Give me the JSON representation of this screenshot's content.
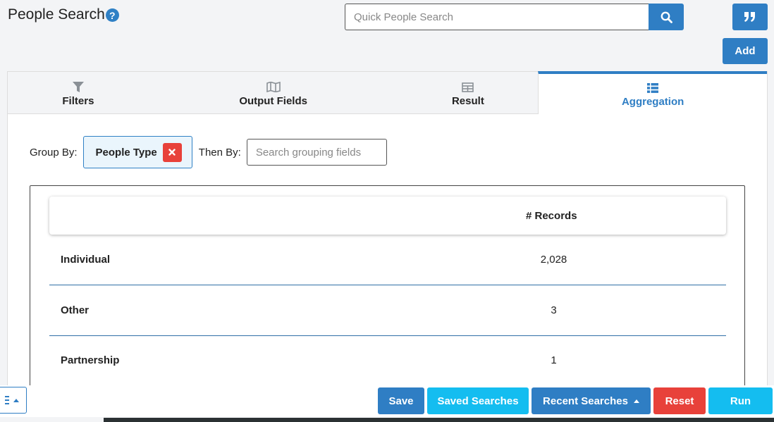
{
  "header": {
    "title": "People Search",
    "help_glyph": "?",
    "quick_search_placeholder": "Quick People Search",
    "add_label": "Add"
  },
  "tabs": [
    {
      "label": "Filters",
      "icon": "filter-icon"
    },
    {
      "label": "Output Fields",
      "icon": "map-icon"
    },
    {
      "label": "Result",
      "icon": "table-icon"
    },
    {
      "label": "Aggregation",
      "icon": "list-icon",
      "active": true
    }
  ],
  "grouping": {
    "group_by_label": "Group By:",
    "group_chip": "People Type",
    "then_by_label": "Then By:",
    "then_by_placeholder": "Search grouping fields"
  },
  "results": {
    "column_header": "# Records",
    "rows": [
      {
        "name": "Individual",
        "count": "2,028"
      },
      {
        "name": "Other",
        "count": "3"
      },
      {
        "name": "Partnership",
        "count": "1"
      }
    ]
  },
  "footer": {
    "save": "Save",
    "saved_searches": "Saved Searches",
    "recent_searches": "Recent Searches",
    "reset": "Reset",
    "run": "Run"
  },
  "colors": {
    "primary": "#2f7ec4",
    "info": "#14bdf0",
    "danger": "#e8413a"
  }
}
